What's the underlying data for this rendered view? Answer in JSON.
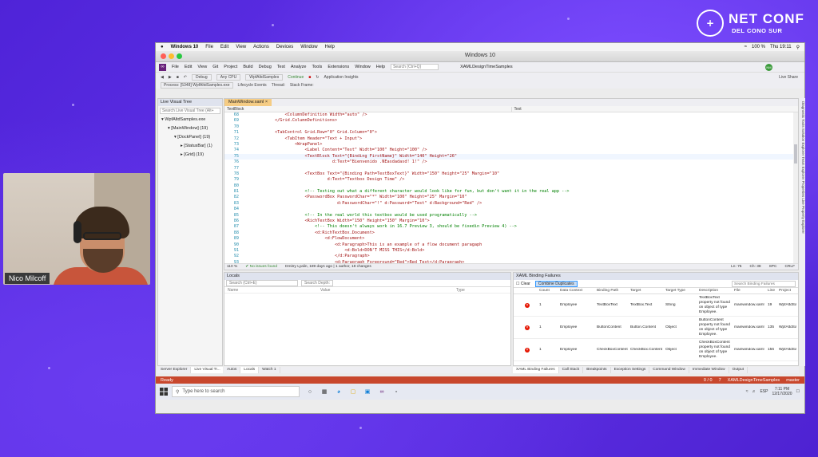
{
  "event_logo": {
    "line1": "NET CONF",
    "line2": "DEL CONO SUR",
    "mark": "+"
  },
  "speaker": {
    "name": "Nico Milcoff"
  },
  "mac_menu": {
    "app": "Windows 10",
    "items": [
      "File",
      "Edit",
      "View",
      "Actions",
      "Devices",
      "Window",
      "Help"
    ],
    "clock": "Thu 19:11",
    "battery": "100 %"
  },
  "vm_window_title": "Windows 10",
  "vs": {
    "menu": [
      "File",
      "Edit",
      "View",
      "Git",
      "Project",
      "Build",
      "Debug",
      "Test",
      "Analyze",
      "Tools",
      "Extensions",
      "Window",
      "Help"
    ],
    "search_placeholder": "Search (Ctrl+Q)",
    "solution": "XAMLDesignTimeSamples",
    "avatar": "NM",
    "toolbar": {
      "config": "Debug",
      "platform": "Any CPU",
      "project": "WpfAltdSamples",
      "continue": "Continue",
      "insights": "Application Insights",
      "live_share": "Live Share"
    },
    "toolbar2": {
      "process": "Process: [5348] WpfAltdSamples.exe",
      "lifecycle": "Lifecycle Events",
      "thread": "Thread:",
      "stack": "Stack Frame:"
    },
    "live_visual_tree": {
      "title": "Live Visual Tree",
      "search": "Search Live Visual Tree (Alt+",
      "nodes": [
        "WpfAltdSamples.exe",
        "[MainWindow] (19)",
        "[DockPanel] (19)",
        "[StatusBar] (1)",
        "[Grid] (19)"
      ]
    },
    "editor": {
      "tab": "MainWindow.xaml",
      "nav_left": "TextBlock",
      "nav_right": "Text",
      "lines": [
        {
          "n": "68",
          "t": "            <ColumnDefinition Width=\"auto\" />"
        },
        {
          "n": "69",
          "t": "        </Grid.ColumnDefinitions>"
        },
        {
          "n": "70",
          "t": ""
        },
        {
          "n": "71",
          "t": "        <TabControl Grid.Row=\"0\" Grid.Column=\"0\">"
        },
        {
          "n": "72",
          "t": "            <TabItem Header=\"Text + Input\">"
        },
        {
          "n": "73",
          "t": "                <WrapPanel>"
        },
        {
          "n": "74",
          "t": "                    <Label Content=\"Test\" Width=\"100\" Height=\"100\" />"
        },
        {
          "n": "75",
          "t": "                    <TextBlock Text=\"{Binding FirstName}\" Width=\"140\" Height=\"26\""
        },
        {
          "n": "76",
          "t": "                               d:Text=\"Bienvenido .NEasdadasd! 1!\" />"
        },
        {
          "n": "77",
          "t": ""
        },
        {
          "n": "78",
          "t": "                    <TextBox Text=\"{Binding Path=TextBoxText}\" Width=\"150\" Height=\"25\" Margin=\"10\""
        },
        {
          "n": "79",
          "t": "                             d:Text=\"Textbox Design Time\" />"
        },
        {
          "n": "80",
          "t": ""
        },
        {
          "n": "81",
          "t": "                    <!-- Testing out what a different character would look like for fun, but don't want it in the real app -->"
        },
        {
          "n": "82",
          "t": "                    <PasswordBox PasswordChar=\"*\" Width=\"100\" Height=\"25\" Margin=\"10\""
        },
        {
          "n": "83",
          "t": "                                 d:PasswordChar=\"!\" d:Password=\"Test\" d:Background=\"Red\" />"
        },
        {
          "n": "84",
          "t": ""
        },
        {
          "n": "85",
          "t": "                    <!-- In the real world this textbox would be used programatically -->"
        },
        {
          "n": "86",
          "t": "                    <RichTextBox Width=\"150\" Height=\"150\" Margin=\"10\">"
        },
        {
          "n": "87",
          "t": "                        <!-- This doesn't always work in 16.7 Preview 3, should be fixedin Preview 4) -->"
        },
        {
          "n": "88",
          "t": "                        <d:RichTextBox.Document>"
        },
        {
          "n": "89",
          "t": "                            <d:FlowDocument>"
        },
        {
          "n": "90",
          "t": "                                <d:Paragraph>This is an example of a flow document paragaph"
        },
        {
          "n": "91",
          "t": "                                    <d:Bold>DON'T MISS THIS</d:Bold>"
        },
        {
          "n": "92",
          "t": "                                </d:Paragraph>"
        },
        {
          "n": "93",
          "t": "                                <d:Paragraph Foreground=\"Red\">Red Text</d:Paragraph>"
        }
      ],
      "zoom": "110 %",
      "issues": "No issues found",
      "git": "Dmitry Lyalin, 189 days ago | 1 author, 18 changes",
      "ln": "Ln: 75",
      "ch": "Ch: 38",
      "spc": "SPC",
      "crlf": "CRLF"
    },
    "locals": {
      "title": "Locals",
      "search": "Search (Ctrl+E)",
      "depth": "Search Depth:",
      "cols": [
        "Name",
        "Value",
        "Type"
      ]
    },
    "binding_failures": {
      "title": "XAML Binding Failures",
      "clear": "Clear",
      "combine": "Combine Duplicates",
      "search": "Search Binding Failures",
      "cols": [
        "Count",
        "Data Context",
        "Binding Path",
        "Target",
        "Target Type",
        "Description",
        "File",
        "Line",
        "Project"
      ],
      "rows": [
        {
          "count": "1",
          "ctx": "Employee",
          "path": "TextBoxText",
          "target": "TextBox.Text",
          "ttype": "String",
          "desc": "TextBoxText property not found on object of type Employee.",
          "file": "mainwindow.xaml",
          "line": "19",
          "project": "WpfAltdSa"
        },
        {
          "count": "1",
          "ctx": "Employee",
          "path": "ButtonContent",
          "target": "Button.Content",
          "ttype": "Object",
          "desc": "ButtonContent property not found on object of type Employee.",
          "file": "mainwindow.xaml",
          "line": "135",
          "project": "WpfAltdSa"
        },
        {
          "count": "1",
          "ctx": "Employee",
          "path": "CheckBoxContent",
          "target": "CheckBox.Content",
          "ttype": "Object",
          "desc": "CheckBoxContent property not found on object of type Employee.",
          "file": "mainwindow.xaml",
          "line": "156",
          "project": "WpfAltdSa"
        }
      ]
    },
    "bottom_tabs_left": [
      "Server Explorer",
      "Live Visual Tr..."
    ],
    "bottom_tabs_mid": [
      "Autos",
      "Locals",
      "Watch 1"
    ],
    "bottom_tabs_right": [
      "XAML Binding Failures",
      "Call Stack",
      "Breakpoints",
      "Exception Settings",
      "Command Window",
      "Immediate Window",
      "Output"
    ],
    "right_rail": "Diagnostic Tools   Solution Explorer   Team Explorer   Properties   Live Property Explorer",
    "status": {
      "ready": "Ready",
      "right": [
        "0 / 0",
        "7",
        "XAMLDesignTimeSamples",
        "master"
      ]
    }
  },
  "taskbar": {
    "search": "Type here to search",
    "time": "7:11 PM",
    "date": "12/17/2020",
    "lang": "ESP"
  }
}
